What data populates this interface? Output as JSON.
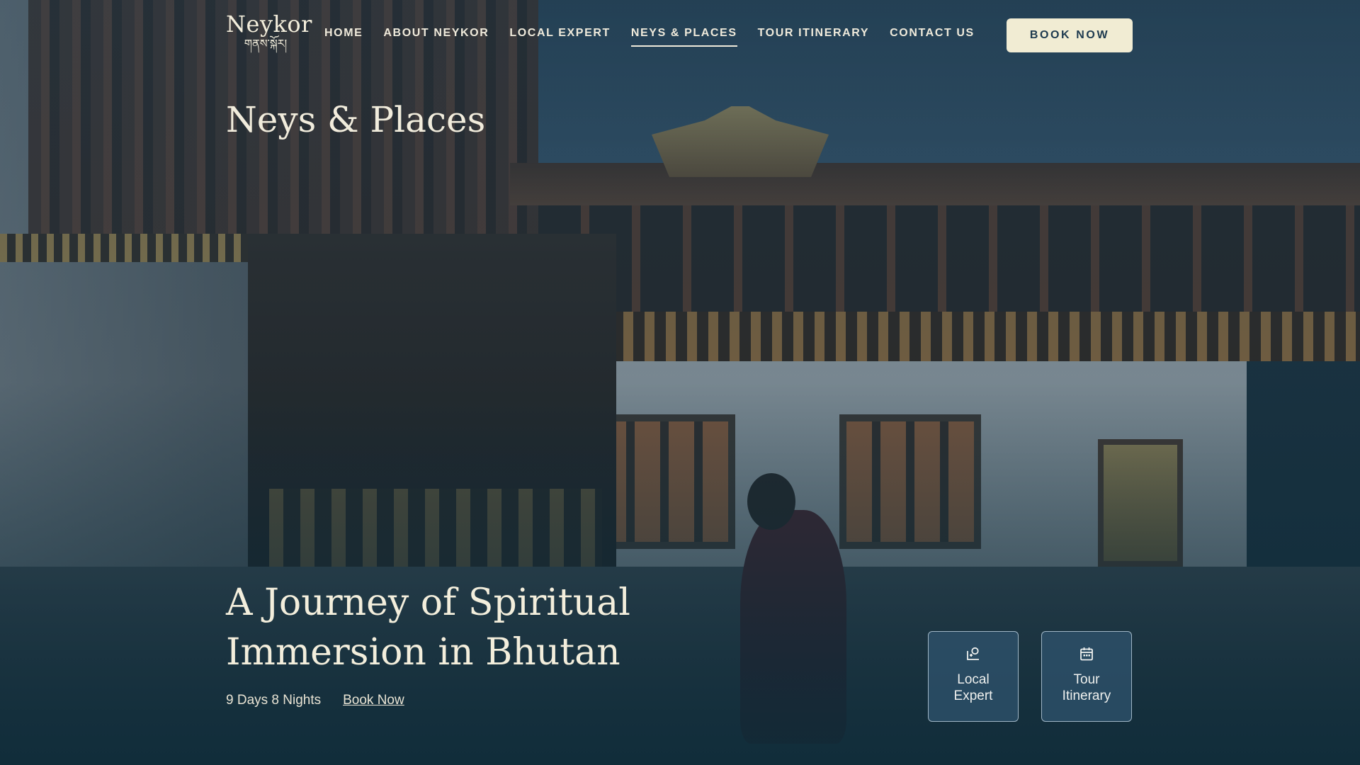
{
  "brand": {
    "name": "Neykor",
    "script_text": "གནས་སྐོར།"
  },
  "nav": {
    "items": [
      {
        "label": "HOME"
      },
      {
        "label": "ABOUT NEYKOR"
      },
      {
        "label": "LOCAL EXPERT"
      },
      {
        "label": "NEYS & PLACES",
        "active": true
      },
      {
        "label": "TOUR ITINERARY"
      },
      {
        "label": "CONTACT US"
      }
    ],
    "book_button": "BOOK NOW"
  },
  "hero": {
    "page_title": "Neys & Places",
    "headline_line1": "A Journey of Spiritual",
    "headline_line2": "Immersion in Bhutan",
    "duration": "9 Days 8 Nights",
    "book_link": "Book Now"
  },
  "tiles": [
    {
      "line1": "Local",
      "line2": "Expert",
      "icon": "local-expert-icon"
    },
    {
      "line1": "Tour",
      "line2": "Itinerary",
      "icon": "calendar-icon"
    }
  ],
  "colors": {
    "accent_cream": "#f1ecd3",
    "deep_teal": "#1e3a4f",
    "tile_bg": "#2e526c",
    "text_light": "#f3eedc"
  }
}
